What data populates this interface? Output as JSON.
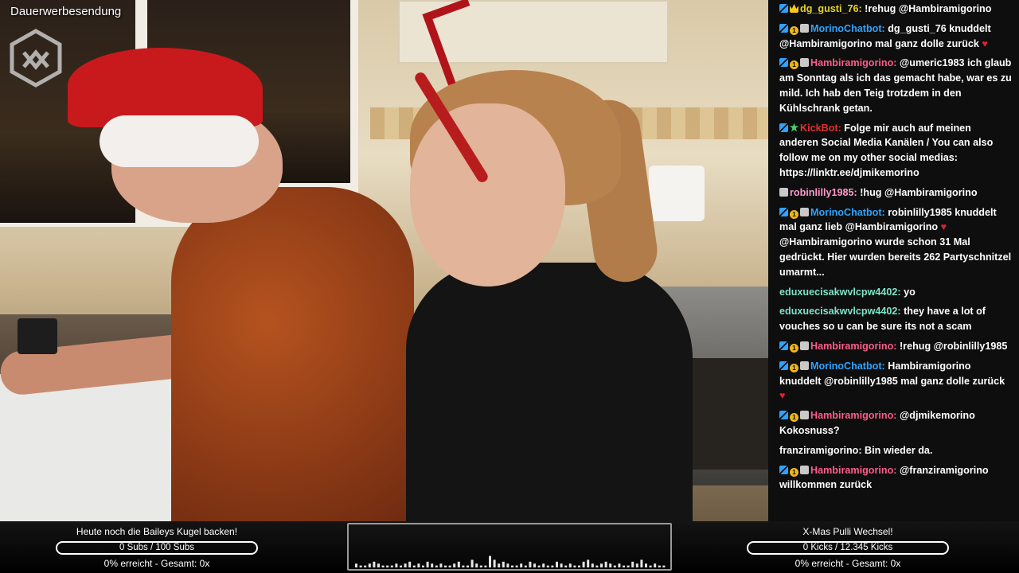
{
  "overlay": {
    "title": "Dauerwerbesendung"
  },
  "chat": {
    "messages": [
      {
        "badges": [
          "sword",
          "crown"
        ],
        "user": "dg_gusti_76:",
        "user_color": "#e6d22c",
        "text": " !rehug @Hambiramigorino",
        "heart": false
      },
      {
        "badges": [
          "sword",
          "one",
          "gift"
        ],
        "user": "MorinoChatbot:",
        "user_color": "#2fa3ff",
        "text": " dg_gusti_76 knuddelt @Hambiramigorino mal ganz dolle zurück ",
        "heart": true
      },
      {
        "badges": [
          "sword",
          "one",
          "gift"
        ],
        "user": "Hambiramigorino:",
        "user_color": "#ff5c8a",
        "text": " @umeric1983 ich glaub am Sonntag als ich das gemacht habe, war es zu mild. Ich hab den Teig trotzdem in den Kühlschrank getan.",
        "heart": false
      },
      {
        "badges": [
          "sword",
          "bot"
        ],
        "user": "KickBot:",
        "user_color": "#e0312a",
        "text": " Folge mir auch auf meinen anderen Social Media Kanälen / You can also follow me on my other social medias: https://linktr.ee/djmikemorino",
        "heart": false
      },
      {
        "badges": [
          "gift"
        ],
        "user": "robinlilly1985:",
        "user_color": "#ff9ad0",
        "text": " !hug @Hambiramigorino",
        "heart": false
      },
      {
        "badges": [
          "sword",
          "one",
          "gift"
        ],
        "user": "MorinoChatbot:",
        "user_color": "#2fa3ff",
        "text": " robinlilly1985 knuddelt mal ganz lieb @Hambiramigorino ",
        "heart": true,
        "after_heart": " @Hambiramigorino wurde schon 31 Mal gedrückt. Hier wurden bereits 262 Partyschnitzel umarmt..."
      },
      {
        "badges": [],
        "user": "eduxuecisakwvlcpw4402:",
        "user_color": "#7fe3c9",
        "text": " yo",
        "heart": false
      },
      {
        "badges": [],
        "user": "eduxuecisakwvlcpw4402:",
        "user_color": "#7fe3c9",
        "text": " they have a lot of vouches so u can be sure its not a scam",
        "heart": false
      },
      {
        "badges": [
          "sword",
          "one",
          "gift"
        ],
        "user": "Hambiramigorino:",
        "user_color": "#ff5c8a",
        "text": " !rehug @robinlilly1985",
        "heart": false
      },
      {
        "badges": [
          "sword",
          "one",
          "gift"
        ],
        "user": "MorinoChatbot:",
        "user_color": "#2fa3ff",
        "text": " Hambiramigorino knuddelt @robinlilly1985 mal ganz dolle zurück ",
        "heart": true
      },
      {
        "badges": [
          "sword",
          "one",
          "gift"
        ],
        "user": "Hambiramigorino:",
        "user_color": "#ff5c8a",
        "text": " @djmikemorino Kokosnuss?",
        "heart": false
      },
      {
        "badges": [],
        "user": "franziramigorino:",
        "user_color": "#ffffff",
        "text": " Bin wieder da.",
        "heart": false
      },
      {
        "badges": [
          "sword",
          "one",
          "gift"
        ],
        "user": "Hambiramigorino:",
        "user_color": "#ff5c8a",
        "text": " @franziramigorino willkommen zurück",
        "heart": false
      }
    ]
  },
  "goals": {
    "left": {
      "title": "Heute noch die Baileys Kugel backen!",
      "bar_text": "0 Subs / 100 Subs",
      "progress": 0,
      "status": "0% erreicht - Gesamt: 0x"
    },
    "right": {
      "title": "X-Mas Pulli Wechsel!",
      "bar_text": "0 Kicks / 12.345 Kicks",
      "progress": 0,
      "status": "0% erreicht - Gesamt: 0x"
    }
  },
  "visualizer": {
    "levels": [
      2,
      1,
      1,
      2,
      3,
      2,
      1,
      1,
      1,
      2,
      1,
      2,
      3,
      1,
      2,
      1,
      3,
      2,
      1,
      2,
      1,
      1,
      2,
      3,
      1,
      1,
      4,
      2,
      1,
      1,
      6,
      4,
      2,
      3,
      2,
      1,
      1,
      2,
      1,
      3,
      2,
      1,
      2,
      1,
      1,
      3,
      2,
      1,
      2,
      1,
      1,
      3,
      4,
      2,
      1,
      2,
      3,
      2,
      1,
      2,
      1,
      1,
      3,
      2,
      4,
      2,
      1,
      2,
      1,
      1
    ]
  },
  "colors": {
    "accent": "#2fa3ff",
    "heart": "#e2212b"
  }
}
